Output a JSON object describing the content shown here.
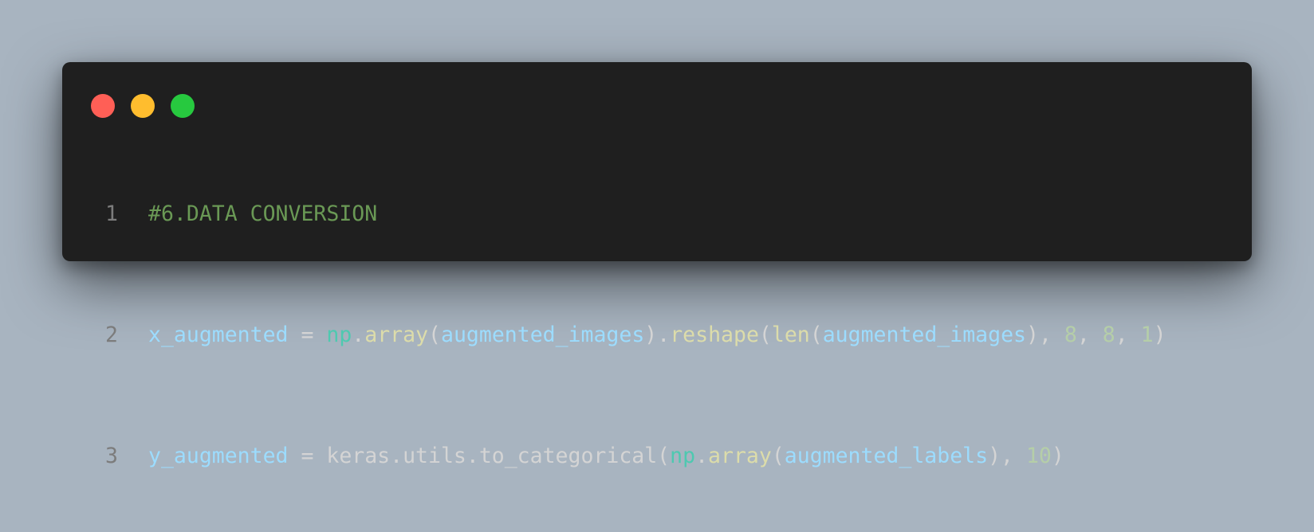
{
  "window": {
    "controls": [
      {
        "name": "close",
        "color": "#ff5f56"
      },
      {
        "name": "minimize",
        "color": "#ffbd2e"
      },
      {
        "name": "maximize",
        "color": "#27c93f"
      }
    ]
  },
  "code": {
    "lines": [
      {
        "number": "1",
        "tokens": [
          {
            "text": "#6.DATA CONVERSION",
            "kind": "comment"
          }
        ]
      },
      {
        "number": "2",
        "tokens": [
          {
            "text": "x_augmented",
            "kind": "var"
          },
          {
            "text": " = ",
            "kind": "plain"
          },
          {
            "text": "np",
            "kind": "module"
          },
          {
            "text": ".",
            "kind": "plain"
          },
          {
            "text": "array",
            "kind": "func"
          },
          {
            "text": "(",
            "kind": "plain"
          },
          {
            "text": "augmented_images",
            "kind": "var"
          },
          {
            "text": ").",
            "kind": "plain"
          },
          {
            "text": "reshape",
            "kind": "func"
          },
          {
            "text": "(",
            "kind": "plain"
          },
          {
            "text": "len",
            "kind": "func"
          },
          {
            "text": "(",
            "kind": "plain"
          },
          {
            "text": "augmented_images",
            "kind": "var"
          },
          {
            "text": "), ",
            "kind": "plain"
          },
          {
            "text": "8",
            "kind": "num"
          },
          {
            "text": ", ",
            "kind": "plain"
          },
          {
            "text": "8",
            "kind": "num"
          },
          {
            "text": ", ",
            "kind": "plain"
          },
          {
            "text": "1",
            "kind": "num"
          },
          {
            "text": ")",
            "kind": "plain"
          }
        ]
      },
      {
        "number": "3",
        "tokens": [
          {
            "text": "y_augmented",
            "kind": "var"
          },
          {
            "text": " = keras.utils.to_categorical(",
            "kind": "plain"
          },
          {
            "text": "np",
            "kind": "module"
          },
          {
            "text": ".",
            "kind": "plain"
          },
          {
            "text": "array",
            "kind": "func"
          },
          {
            "text": "(",
            "kind": "plain"
          },
          {
            "text": "augmented_labels",
            "kind": "var"
          },
          {
            "text": "), ",
            "kind": "plain"
          },
          {
            "text": "10",
            "kind": "num"
          },
          {
            "text": ")",
            "kind": "plain"
          }
        ]
      }
    ]
  }
}
